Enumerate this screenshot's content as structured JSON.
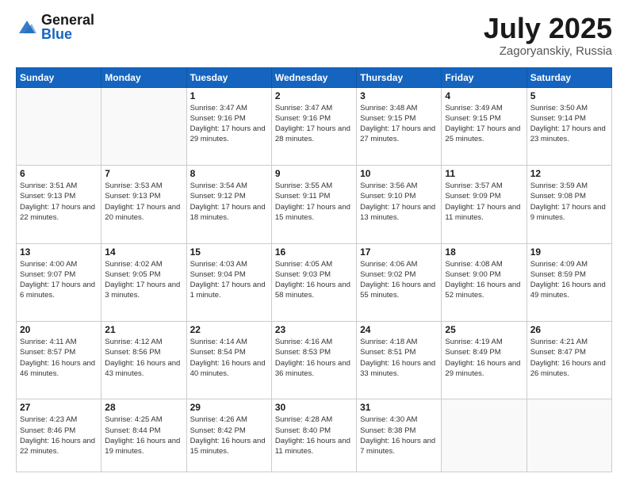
{
  "header": {
    "logo_general": "General",
    "logo_blue": "Blue",
    "month_title": "July 2025",
    "location": "Zagoryanskiy, Russia"
  },
  "days_of_week": [
    "Sunday",
    "Monday",
    "Tuesday",
    "Wednesday",
    "Thursday",
    "Friday",
    "Saturday"
  ],
  "weeks": [
    [
      {
        "day": "",
        "info": ""
      },
      {
        "day": "",
        "info": ""
      },
      {
        "day": "1",
        "info": "Sunrise: 3:47 AM\nSunset: 9:16 PM\nDaylight: 17 hours and 29 minutes."
      },
      {
        "day": "2",
        "info": "Sunrise: 3:47 AM\nSunset: 9:16 PM\nDaylight: 17 hours and 28 minutes."
      },
      {
        "day": "3",
        "info": "Sunrise: 3:48 AM\nSunset: 9:15 PM\nDaylight: 17 hours and 27 minutes."
      },
      {
        "day": "4",
        "info": "Sunrise: 3:49 AM\nSunset: 9:15 PM\nDaylight: 17 hours and 25 minutes."
      },
      {
        "day": "5",
        "info": "Sunrise: 3:50 AM\nSunset: 9:14 PM\nDaylight: 17 hours and 23 minutes."
      }
    ],
    [
      {
        "day": "6",
        "info": "Sunrise: 3:51 AM\nSunset: 9:13 PM\nDaylight: 17 hours and 22 minutes."
      },
      {
        "day": "7",
        "info": "Sunrise: 3:53 AM\nSunset: 9:13 PM\nDaylight: 17 hours and 20 minutes."
      },
      {
        "day": "8",
        "info": "Sunrise: 3:54 AM\nSunset: 9:12 PM\nDaylight: 17 hours and 18 minutes."
      },
      {
        "day": "9",
        "info": "Sunrise: 3:55 AM\nSunset: 9:11 PM\nDaylight: 17 hours and 15 minutes."
      },
      {
        "day": "10",
        "info": "Sunrise: 3:56 AM\nSunset: 9:10 PM\nDaylight: 17 hours and 13 minutes."
      },
      {
        "day": "11",
        "info": "Sunrise: 3:57 AM\nSunset: 9:09 PM\nDaylight: 17 hours and 11 minutes."
      },
      {
        "day": "12",
        "info": "Sunrise: 3:59 AM\nSunset: 9:08 PM\nDaylight: 17 hours and 9 minutes."
      }
    ],
    [
      {
        "day": "13",
        "info": "Sunrise: 4:00 AM\nSunset: 9:07 PM\nDaylight: 17 hours and 6 minutes."
      },
      {
        "day": "14",
        "info": "Sunrise: 4:02 AM\nSunset: 9:05 PM\nDaylight: 17 hours and 3 minutes."
      },
      {
        "day": "15",
        "info": "Sunrise: 4:03 AM\nSunset: 9:04 PM\nDaylight: 17 hours and 1 minute."
      },
      {
        "day": "16",
        "info": "Sunrise: 4:05 AM\nSunset: 9:03 PM\nDaylight: 16 hours and 58 minutes."
      },
      {
        "day": "17",
        "info": "Sunrise: 4:06 AM\nSunset: 9:02 PM\nDaylight: 16 hours and 55 minutes."
      },
      {
        "day": "18",
        "info": "Sunrise: 4:08 AM\nSunset: 9:00 PM\nDaylight: 16 hours and 52 minutes."
      },
      {
        "day": "19",
        "info": "Sunrise: 4:09 AM\nSunset: 8:59 PM\nDaylight: 16 hours and 49 minutes."
      }
    ],
    [
      {
        "day": "20",
        "info": "Sunrise: 4:11 AM\nSunset: 8:57 PM\nDaylight: 16 hours and 46 minutes."
      },
      {
        "day": "21",
        "info": "Sunrise: 4:12 AM\nSunset: 8:56 PM\nDaylight: 16 hours and 43 minutes."
      },
      {
        "day": "22",
        "info": "Sunrise: 4:14 AM\nSunset: 8:54 PM\nDaylight: 16 hours and 40 minutes."
      },
      {
        "day": "23",
        "info": "Sunrise: 4:16 AM\nSunset: 8:53 PM\nDaylight: 16 hours and 36 minutes."
      },
      {
        "day": "24",
        "info": "Sunrise: 4:18 AM\nSunset: 8:51 PM\nDaylight: 16 hours and 33 minutes."
      },
      {
        "day": "25",
        "info": "Sunrise: 4:19 AM\nSunset: 8:49 PM\nDaylight: 16 hours and 29 minutes."
      },
      {
        "day": "26",
        "info": "Sunrise: 4:21 AM\nSunset: 8:47 PM\nDaylight: 16 hours and 26 minutes."
      }
    ],
    [
      {
        "day": "27",
        "info": "Sunrise: 4:23 AM\nSunset: 8:46 PM\nDaylight: 16 hours and 22 minutes."
      },
      {
        "day": "28",
        "info": "Sunrise: 4:25 AM\nSunset: 8:44 PM\nDaylight: 16 hours and 19 minutes."
      },
      {
        "day": "29",
        "info": "Sunrise: 4:26 AM\nSunset: 8:42 PM\nDaylight: 16 hours and 15 minutes."
      },
      {
        "day": "30",
        "info": "Sunrise: 4:28 AM\nSunset: 8:40 PM\nDaylight: 16 hours and 11 minutes."
      },
      {
        "day": "31",
        "info": "Sunrise: 4:30 AM\nSunset: 8:38 PM\nDaylight: 16 hours and 7 minutes."
      },
      {
        "day": "",
        "info": ""
      },
      {
        "day": "",
        "info": ""
      }
    ]
  ]
}
